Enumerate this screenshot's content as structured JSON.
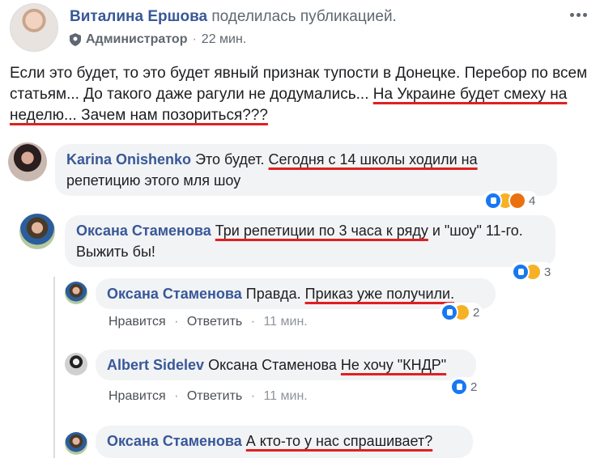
{
  "post": {
    "author": "Виталина Ершова",
    "action": "поделилась публикацией.",
    "role": "Администратор",
    "time": "22 мин.",
    "text_plain": "Если это будет, то это будет явный признак тупости в Донецке. Перебор по всем статьям... До такого даже рагули не додумались... ",
    "text_underlined": "На Украине будет смеху на неделю... Зачем нам позориться???"
  },
  "comments": [
    {
      "author": "Karina Onishenko",
      "text_plain": "Это будет. ",
      "text_underlined": "Сегодня с 14 школы ходили на",
      "text_after": " репетицию этого мля шоу",
      "reactions": [
        "like-icon",
        "sad-icon",
        "angry-icon"
      ],
      "reaction_count": "4"
    },
    {
      "author": "Оксана Стаменова",
      "text_plain": "",
      "text_underlined": "Три репетиции по 3 часа к ряду",
      "text_after": " и \"шоу\" 11-го. Выжить бы!",
      "reactions": [
        "like-icon",
        "sad-icon"
      ],
      "reaction_count": "3"
    }
  ],
  "replies": [
    {
      "author": "Оксана Стаменова",
      "text_plain": "Правда. ",
      "text_underlined": "Приказ уже получили.",
      "like": "Нравится",
      "reply": "Ответить",
      "time": "11 мин.",
      "reactions": [
        "like-icon",
        "sad-icon"
      ],
      "reaction_count": "2"
    },
    {
      "author": "Albert Sidelev",
      "mention": "Оксана Стаменова",
      "text_underlined": "Не хочу \"КНДР\"",
      "like": "Нравится",
      "reply": "Ответить",
      "time": "11 мин.",
      "reactions": [
        "like-icon"
      ],
      "reaction_count": "2"
    },
    {
      "author": "Оксана Стаменова",
      "text_plain": "",
      "text_underlined": "А кто-то у нас спрашивает?"
    }
  ],
  "ui": {
    "dot": "·"
  }
}
